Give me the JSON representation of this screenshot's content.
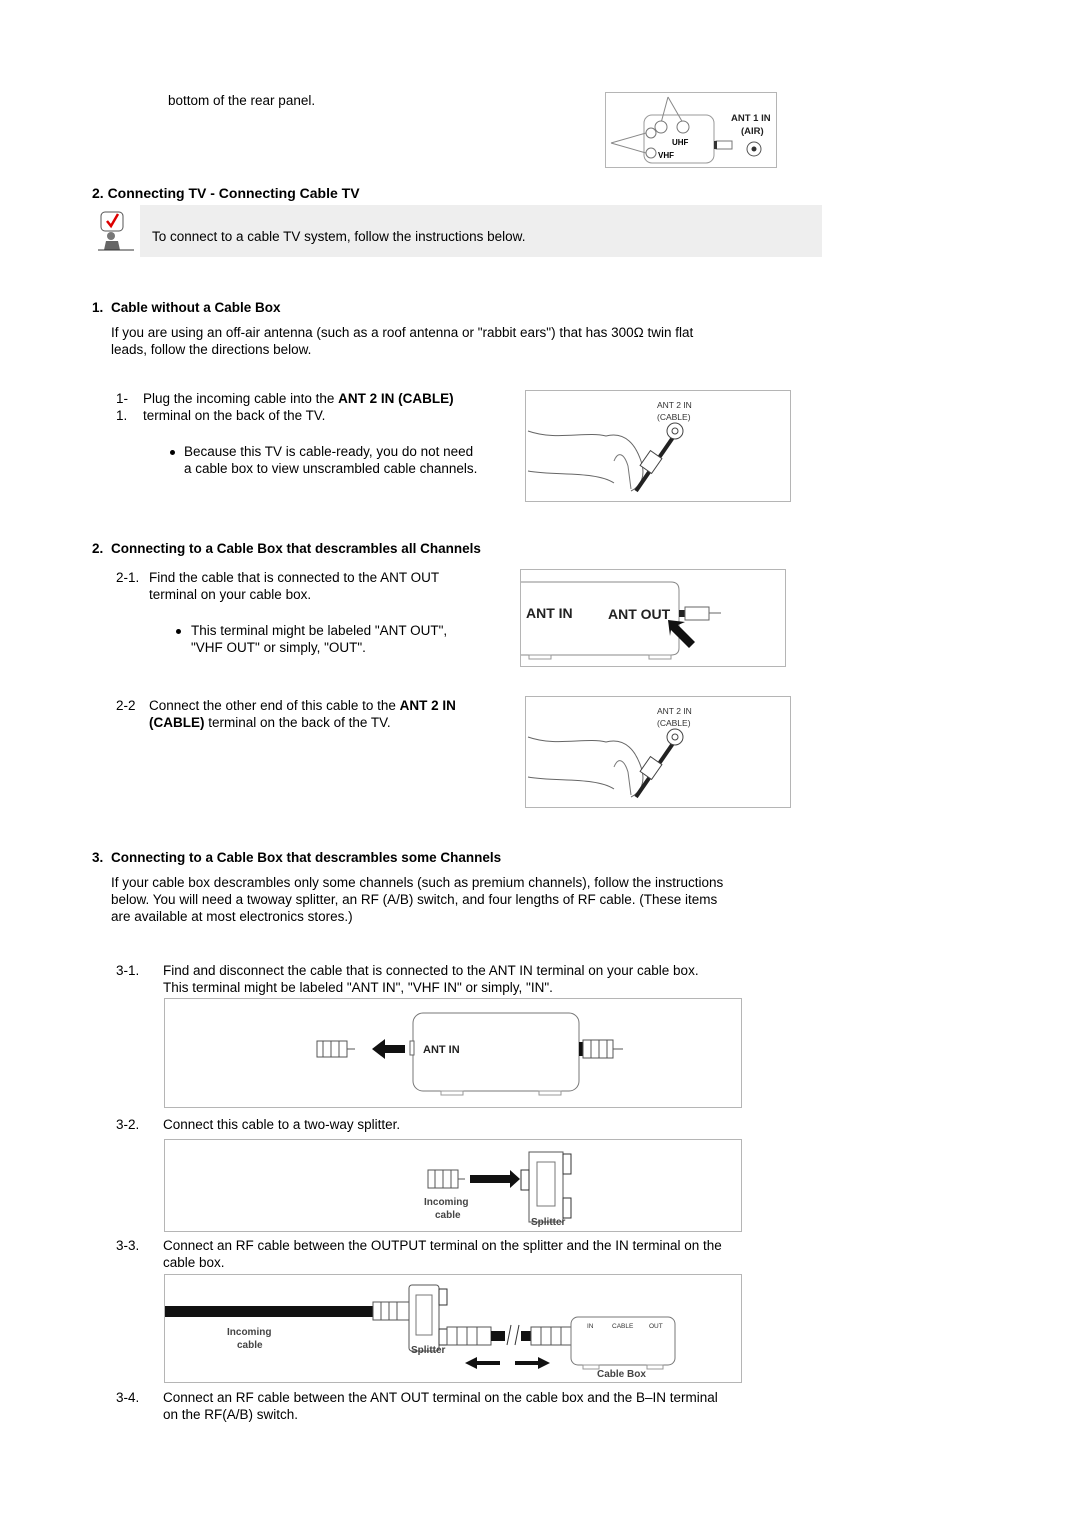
{
  "top": {
    "continuation_text": "bottom of the rear panel.",
    "figure_ant1": {
      "label_line1": "ANT 1 IN",
      "label_line2": "(AIR)",
      "uhf": "UHF",
      "vhf": "VHF"
    }
  },
  "section": {
    "title": "2. Connecting TV - Connecting Cable TV",
    "note": {
      "icon": "checkmark-person-note-icon",
      "text": "To connect to a cable TV system, follow the instructions below."
    }
  },
  "sub1": {
    "number": "1.",
    "title": "Cable without a Cable Box",
    "intro_line1": "If you are using an off-air antenna (such as a roof antenna or \"rabbit ears\") that has 300Ω twin flat",
    "intro_line2": "leads, follow the directions below.",
    "step": {
      "num_line1": "1-",
      "num_line2": "1.",
      "text_pre": "Plug the incoming cable into the ",
      "text_bold": "ANT 2 IN (CABLE)",
      "text_line2": "terminal on the back of the TV.",
      "bullet_line1": "Because this TV is cable-ready, you do not need",
      "bullet_line2": "a cable box to view unscrambled cable channels."
    },
    "figure": {
      "label_line1": "ANT 2 IN",
      "label_line2": "(CABLE)"
    }
  },
  "sub2": {
    "number": "2.",
    "title": "Connecting to a Cable Box that descrambles all Channels",
    "step1": {
      "num": "2-1.",
      "line1": "Find the cable that is connected to the ANT OUT",
      "line2": "terminal on your cable box.",
      "bullet_line1": "This terminal might be labeled \"ANT OUT\",",
      "bullet_line2": "\"VHF OUT\" or simply, \"OUT\"."
    },
    "figure1": {
      "ant_in": "ANT IN",
      "ant_out": "ANT OUT"
    },
    "step2": {
      "num": "2-2",
      "line1_pre": "Connect the other end of this cable to the ",
      "line1_bold": "ANT 2 IN",
      "line2_bold": "(CABLE)",
      "line2_rest": " terminal on the back of the TV."
    },
    "figure2": {
      "label_line1": "ANT 2 IN",
      "label_line2": "(CABLE)"
    }
  },
  "sub3": {
    "number": "3.",
    "title": "Connecting to a Cable Box that descrambles some Channels",
    "intro_line1": "If your cable box descrambles only some channels (such as premium channels), follow the instructions",
    "intro_line2": "below. You will need a twoway splitter, an RF (A/B) switch, and four lengths of RF cable. (These items",
    "intro_line3": "are available at most electronics stores.)",
    "steps": [
      {
        "num": "3-1.",
        "line1": "Find and disconnect the cable that is connected to the ANT IN terminal on your cable box.",
        "line2": "This terminal might be labeled \"ANT IN\", \"VHF IN\" or simply, \"IN\"."
      },
      {
        "num": "3-2.",
        "line1": "Connect this cable to a two-way splitter.",
        "line2": ""
      },
      {
        "num": "3-3.",
        "line1": "Connect an RF cable between the OUTPUT terminal on the splitter and the IN terminal on the",
        "line2": "cable box."
      },
      {
        "num": "3-4.",
        "line1": "Connect an RF cable between the ANT OUT terminal on the cable box and the B–IN terminal",
        "line2": "on the RF(A/B) switch."
      }
    ],
    "figure31": {
      "ant_in": "ANT IN"
    },
    "figure32": {
      "incoming_line1": "Incoming",
      "incoming_line2": "cable",
      "splitter": "Splitter"
    },
    "figure33": {
      "incoming_line1": "Incoming",
      "incoming_line2": "cable",
      "splitter": "Splitter",
      "box_in": "IN",
      "box_cable": "CABLE",
      "box_out": "OUT",
      "cable_box": "Cable Box"
    }
  }
}
